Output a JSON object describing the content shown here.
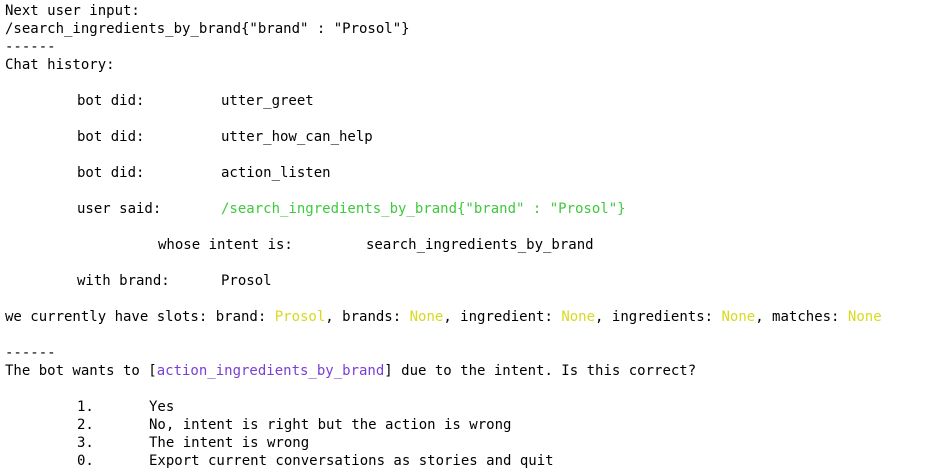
{
  "header": {
    "next_input_label": "Next user input:",
    "next_input_value": "/search_ingredients_by_brand{\"brand\" : \"Prosol\"}",
    "separator_1": "------",
    "chat_history_label": "Chat history:"
  },
  "history": {
    "bot1_label": "bot did:",
    "bot1_action": "utter_greet",
    "bot2_label": "bot did:",
    "bot2_action": "utter_how_can_help",
    "bot3_label": "bot did:",
    "bot3_action": "action_listen",
    "user_label": "user said:",
    "user_message": "/search_ingredients_by_brand{\"brand\" : \"Prosol\"}",
    "intent_label": "whose intent is:",
    "intent_value": "search_ingredients_by_brand",
    "brand_label": "with brand:",
    "brand_value": "Prosol"
  },
  "slots": {
    "prefix": "we currently have slots: brand: ",
    "brand_value": "Prosol",
    "brands_label": ", brands: ",
    "brands_value": "None",
    "ingredient_label": ", ingredient: ",
    "ingredient_value": "None",
    "ingredients_label": ", ingredients: ",
    "ingredients_value": "None",
    "matches_label": ", matches: ",
    "matches_value": "None"
  },
  "prompt": {
    "separator_2": "------",
    "question_prefix": "The bot wants to [",
    "action_name": "action_ingredients_by_brand",
    "question_suffix": "] due to the intent. Is this correct?"
  },
  "options": [
    {
      "key": "1.",
      "text": "Yes"
    },
    {
      "key": "2.",
      "text": "No, intent is right but the action is wrong"
    },
    {
      "key": "3.",
      "text": "The intent is wrong"
    },
    {
      "key": "0.",
      "text": "Export current conversations as stories and quit"
    }
  ],
  "colors": {
    "user_message": "#3ec93e",
    "slot_value": "#d9d921",
    "action_name": "#7a3fd6"
  }
}
